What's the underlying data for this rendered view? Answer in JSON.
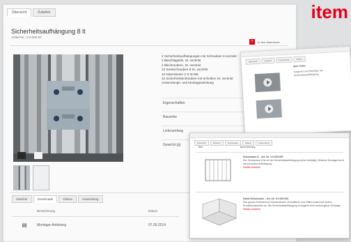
{
  "brand": {
    "logo": "item",
    "color": "#e3001b"
  },
  "top_tabs": [
    {
      "label": "Übersicht"
    },
    {
      "label": "Zubehör"
    }
  ],
  "product": {
    "title": "Sicherheitsaufhängung 8 lt",
    "article_no": "Artikel-Nr.: 0.0.000.00",
    "cart_label": "In den Warenkorb"
  },
  "description": [
    "2 Sicherheitsaufhängungen mit Schrauben 8 verzinkt",
    "2 Beschlagteile, St. verzinkt",
    "2 Blechmuttern, St. verzinkt",
    "12 Senkschrauben 8 St. verzinkt",
    "12 Nutensteine V 8 St-M6",
    "12 Sicherheitsschrauben mit Scheiben St. verzinkt",
    "Anwendungs- und Montageanleitung"
  ],
  "specs": [
    {
      "label": "Eigenschaften"
    },
    {
      "label": "Baureihe"
    },
    {
      "label": "Lieferumfang"
    },
    {
      "label": "Gewicht (g)"
    }
  ],
  "bottom_tabs": [
    {
      "label": "Zubehör"
    },
    {
      "label": "Downloads"
    },
    {
      "label": "Videos"
    },
    {
      "label": "Anwendung"
    }
  ],
  "table": {
    "headers": {
      "name": "Bezeichnung",
      "date": "Datum"
    },
    "rows": [
      {
        "name": "Montage-Anleitung",
        "date": "07.05.2014"
      }
    ]
  },
  "video_window": {
    "tabs": [
      "Übersicht",
      "Zubehör",
      "Downloads",
      "Videos",
      "Anwendung"
    ],
    "heading": "Item Video",
    "caption": "Vorgehen und Montage der Sicherheitsaufhängung"
  },
  "application_window": {
    "tabs": [
      "Übersicht",
      "Zubehör",
      "Downloads",
      "Videos",
      "Anwendung"
    ],
    "header_a": "Bild",
    "header_b": "Beschreibung",
    "items": [
      {
        "title": "Schutzzaun 8 – Art.-Nr. 0.0.000.000",
        "text": "Der Schutzzaun 8 ist mit der Sicherheitsaufhängung sicher befestigt. Einfache Montage durch die innovative Aufhängung.",
        "link": "Details ansehen"
      },
      {
        "title": "Kabel-Schutzzaun – Art.-Nr. 0.0.000.000",
        "text": "Das grosse Sortiment an Schutzzäunen, Schutztüren und Gittern passt sich jedem Produktionsumfeld an. Die Sicherheitsaufhängung ermöglicht eine werkzeuglose Montage.",
        "link": "Details ansehen"
      }
    ]
  }
}
